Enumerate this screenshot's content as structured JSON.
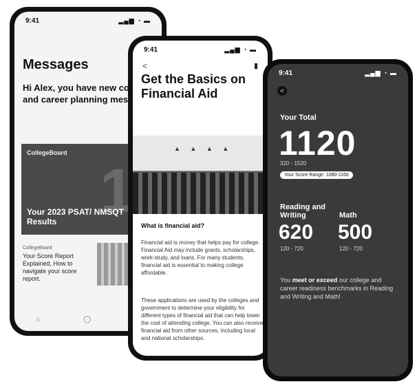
{
  "status": {
    "time": "9:41",
    "icons": "▂▄▆ ◔ ▬"
  },
  "phone1": {
    "title": "Messages",
    "greeting": "Hi Alex, you have new college and career planning messages¹",
    "card": {
      "brand": "CollegeBoard",
      "watermark": "12",
      "title": "Your 2023 PSAT/ NMSQT Results"
    },
    "item": {
      "source": "CollegeBoard",
      "text": "Your Score Report Explained, How to navigate your score report."
    },
    "tabs": [
      "⌂",
      "◯",
      "☰"
    ]
  },
  "phone2": {
    "back": "<",
    "title": "Get the Basics on Financial Aid",
    "heading": "What is financial aid?",
    "paragraph1": "Financial aid is money that helps pay for college. Financial Aid may include grants, scholarships, work-study, and loans. For many students, financial aid is essential to making college affordable.",
    "paragraph2": "These applications are used by the colleges and government to determine your eligibility for different types of financial aid that can help lower the cost of attending college. You can also receive financial aid from other sources, including local and national scholarships."
  },
  "phone3": {
    "back": "<",
    "total_label": "Your Total",
    "total": "1120",
    "total_range": "320 - 1520",
    "range_pill": "Your Score Range: 1080-1160",
    "rw_label": "Reading and Writing",
    "rw_score": "620",
    "rw_range": "120 - 720",
    "math_label": "Math",
    "math_score": "500",
    "math_range": "120 - 720",
    "message_bold": "meet or exceed",
    "message_pre": "You ",
    "message_post": " our college and career readiness benchmarks in Reading and Writing and Math!"
  }
}
